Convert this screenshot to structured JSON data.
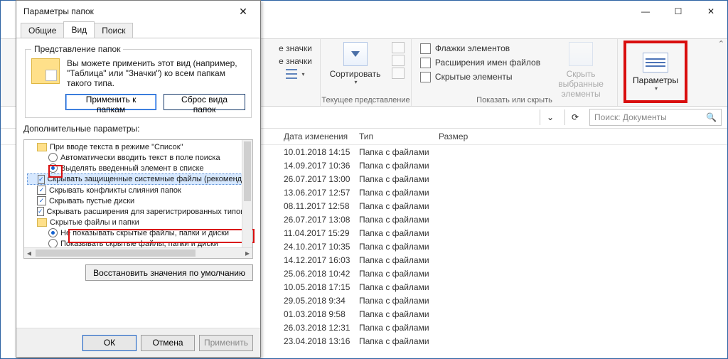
{
  "dialog": {
    "title": "Параметры папок",
    "tabs": {
      "general": "Общие",
      "view": "Вид",
      "search": "Поиск"
    },
    "folder_views": {
      "legend": "Представление папок",
      "text": "Вы можете применить этот вид (например, \"Таблица\" или \"Значки\") ко всем папкам такого типа.",
      "apply": "Применить к папкам",
      "reset": "Сброс вида папок"
    },
    "adv_label": "Дополнительные параметры:",
    "tree": {
      "n0": "При вводе текста в режиме \"Список\"",
      "n0a": "Автоматически вводить текст в поле поиска",
      "n0b": "Выделять введенный элемент в списке",
      "n1": "Скрывать защищенные системные файлы (рекомендуется)",
      "n2": "Скрывать конфликты слияния папок",
      "n3": "Скрывать пустые диски",
      "n4": "Скрывать расширения для зарегистрированных типов",
      "n5": "Скрытые файлы и папки",
      "n5a": "Не показывать скрытые файлы, папки и диски",
      "n5b": "Показывать скрытые файлы, папки и диски"
    },
    "restore": "Восстановить значения по умолчанию",
    "ok": "ОК",
    "cancel": "Отмена",
    "apply": "Применить"
  },
  "ribbon": {
    "icons_large": "е значки",
    "icons_med": "е значки",
    "sort": {
      "label": "Сортировать",
      "group": "Текущее представление"
    },
    "show_hide": {
      "chk1": "Флажки элементов",
      "chk2": "Расширения имен файлов",
      "chk3": "Скрытые элементы",
      "hide_sel": "Скрыть выбранные элементы",
      "group": "Показать или скрыть"
    },
    "options": "Параметры"
  },
  "addr": {
    "search_ph": "Поиск: Документы"
  },
  "columns": {
    "c1": "Дата изменения",
    "c2": "Тип",
    "c3": "Размер"
  },
  "type_folder": "Папка с файлами",
  "rows": [
    {
      "d": "10.01.2018 14:15"
    },
    {
      "d": "14.09.2017 10:36"
    },
    {
      "d": "26.07.2017 13:00"
    },
    {
      "d": "13.06.2017 12:57"
    },
    {
      "d": "08.11.2017 12:58"
    },
    {
      "d": "26.07.2017 13:08"
    },
    {
      "d": "11.04.2017 15:29"
    },
    {
      "d": "24.10.2017 10:35"
    },
    {
      "d": "14.12.2017 16:03"
    },
    {
      "d": "25.06.2018 10:42"
    },
    {
      "d": "10.05.2018 17:15"
    },
    {
      "d": "29.05.2018 9:34"
    },
    {
      "d": "01.03.2018 9:58"
    },
    {
      "d": "26.03.2018 12:31"
    },
    {
      "d": "23.04.2018 13:16"
    }
  ]
}
